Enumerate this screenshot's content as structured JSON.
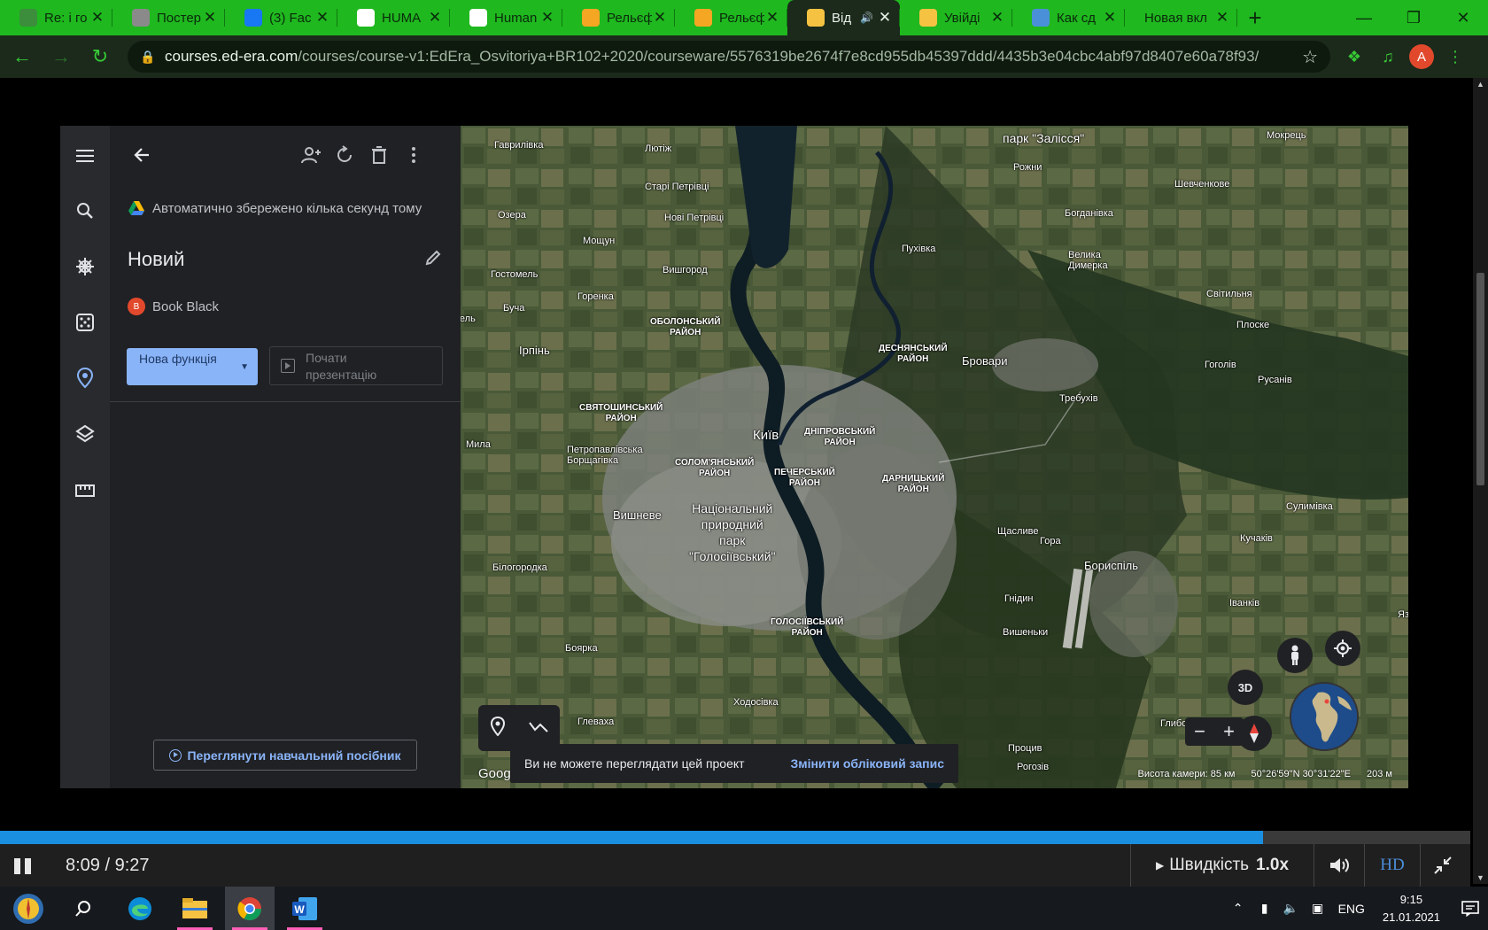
{
  "browser": {
    "tabs": [
      {
        "title": "Re: і го",
        "favicon": "mail-icon",
        "color": "#3c8e3c"
      },
      {
        "title": "Постер",
        "favicon": "globe-icon",
        "color": "#8a8a8a"
      },
      {
        "title": "(3) Fac",
        "favicon": "facebook-icon",
        "color": "#1877f2"
      },
      {
        "title": "HUMA",
        "favicon": "human-icon",
        "color": "#ffffff"
      },
      {
        "title": "Human",
        "favicon": "human-icon",
        "color": "#ffffff"
      },
      {
        "title": "Рельєф",
        "favicon": "relief-icon",
        "color": "#f5a623"
      },
      {
        "title": "Рельєф",
        "favicon": "relief-icon",
        "color": "#f5a623"
      },
      {
        "title": "Від",
        "favicon": "hand-icon",
        "color": "#f5c242",
        "muted": true
      },
      {
        "title": "Увійді",
        "favicon": "hand-icon",
        "color": "#f5c242"
      },
      {
        "title": "Как сд",
        "favicon": "translate-icon",
        "color": "#4a90d9"
      },
      {
        "title": "Новая вкл",
        "favicon": "none",
        "color": ""
      }
    ],
    "active_tab_index": 7,
    "url_domain": "courses.ed-era.com",
    "url_path": "/courses/course-v1:EdEra_Osvitoriya+BR102+2020/courseware/5576319be2674f7e8cd955db45397ddd/4435b3e04cbc4abf97d8407e60a78f93/",
    "profile_initial": "A"
  },
  "earth": {
    "autosave_text": "Автоматично збережено кілька секунд тому",
    "project_title": "Новий",
    "owner_initial": "B",
    "owner_name": "Book Black",
    "new_feature_label": "Нова функція",
    "present_label": "Почати презентацію",
    "tutorial_label": "Переглянути навчальний посібник",
    "message_text": "Ви не можете переглядати цей проект",
    "message_action": "Змінити обліковий запис",
    "google_logo": "Goog",
    "camera_altitude": "Висота камери: 85 км",
    "coordinates": "50°26'59\"N 30°31'22\"E",
    "scale": "203 м",
    "btn_3d": "3D",
    "map_labels": [
      {
        "text": "Гаврилівка",
        "cls": ""
      },
      {
        "text": "Лютіж",
        "cls": ""
      },
      {
        "text": "Старі Петрівці",
        "cls": ""
      },
      {
        "text": "Нові Петрівці",
        "cls": ""
      },
      {
        "text": "Озера",
        "cls": ""
      },
      {
        "text": "Мощун",
        "cls": ""
      },
      {
        "text": "Гостомель",
        "cls": ""
      },
      {
        "text": "Горенка",
        "cls": ""
      },
      {
        "text": "Вишгород",
        "cls": ""
      },
      {
        "text": "Буча",
        "cls": ""
      },
      {
        "text": "зель",
        "cls": ""
      },
      {
        "text": "Ірпінь",
        "cls": "mid"
      },
      {
        "text": "Рожни",
        "cls": ""
      },
      {
        "text": "Пухівка",
        "cls": ""
      },
      {
        "text": "Мокрець",
        "cls": ""
      },
      {
        "text": "Шевченкове",
        "cls": ""
      },
      {
        "text": "Богданівка",
        "cls": ""
      },
      {
        "text": "Велика\nДимерка",
        "cls": ""
      },
      {
        "text": "Світильня",
        "cls": ""
      },
      {
        "text": "Плоске",
        "cls": ""
      },
      {
        "text": "Бровари",
        "cls": "mid"
      },
      {
        "text": "Гоголів",
        "cls": ""
      },
      {
        "text": "Русанів",
        "cls": ""
      },
      {
        "text": "Требухів",
        "cls": ""
      },
      {
        "text": "Київ",
        "cls": "big"
      },
      {
        "text": "Мила",
        "cls": ""
      },
      {
        "text": "Петропавлівська\nБорщагівка",
        "cls": ""
      },
      {
        "text": "Вишневе",
        "cls": "mid"
      },
      {
        "text": "Білогородка",
        "cls": ""
      },
      {
        "text": "Боярка",
        "cls": ""
      },
      {
        "text": "Глеваха",
        "cls": ""
      },
      {
        "text": "Ходосівка",
        "cls": ""
      },
      {
        "text": "Гнідин",
        "cls": ""
      },
      {
        "text": "Вишеньки",
        "cls": ""
      },
      {
        "text": "Щасливе",
        "cls": ""
      },
      {
        "text": "Гора",
        "cls": ""
      },
      {
        "text": "Бориспіль",
        "cls": "mid"
      },
      {
        "text": "Кучаків",
        "cls": ""
      },
      {
        "text": "Сулимівка",
        "cls": ""
      },
      {
        "text": "Іванків",
        "cls": ""
      },
      {
        "text": "Глибоке",
        "cls": ""
      },
      {
        "text": "Процив",
        "cls": ""
      },
      {
        "text": "Рогозів",
        "cls": ""
      },
      {
        "text": "Язв",
        "cls": ""
      },
      {
        "text": "ОБОЛОНСЬКИЙ\nРАЙОН",
        "cls": "dist"
      },
      {
        "text": "ДЕСНЯНСЬКИЙ\nРАЙОН",
        "cls": "dist"
      },
      {
        "text": "СВЯТОШИНСЬКИЙ\nРАЙОН",
        "cls": "dist"
      },
      {
        "text": "ДНІПРОВСЬКИЙ\nРАЙОН",
        "cls": "dist"
      },
      {
        "text": "СОЛОМ'ЯНСЬКИЙ\nРАЙОН",
        "cls": "dist"
      },
      {
        "text": "ПЕЧЕРСЬКИЙ\nРАЙОН",
        "cls": "dist"
      },
      {
        "text": "ДАРНИЦЬКИЙ\nРАЙОН",
        "cls": "dist"
      },
      {
        "text": "ГОЛОСІЇВСЬКИЙ\nРАЙОН",
        "cls": "dist"
      },
      {
        "text": "Національний\nприродний\nпарк\n\"Голосіївський\"",
        "cls": "park"
      },
      {
        "text": "парк \"Залісся\"",
        "cls": "park"
      }
    ]
  },
  "player": {
    "progress": 0.859,
    "time_current": "8:09",
    "time_total": "9:27",
    "time_display": "8:09 / 9:27",
    "speed_label": "Швидкість",
    "speed_value": "1.0x",
    "quality_label": "HD"
  },
  "taskbar": {
    "lang": "ENG",
    "time": "9:15",
    "date": "21.01.2021"
  }
}
